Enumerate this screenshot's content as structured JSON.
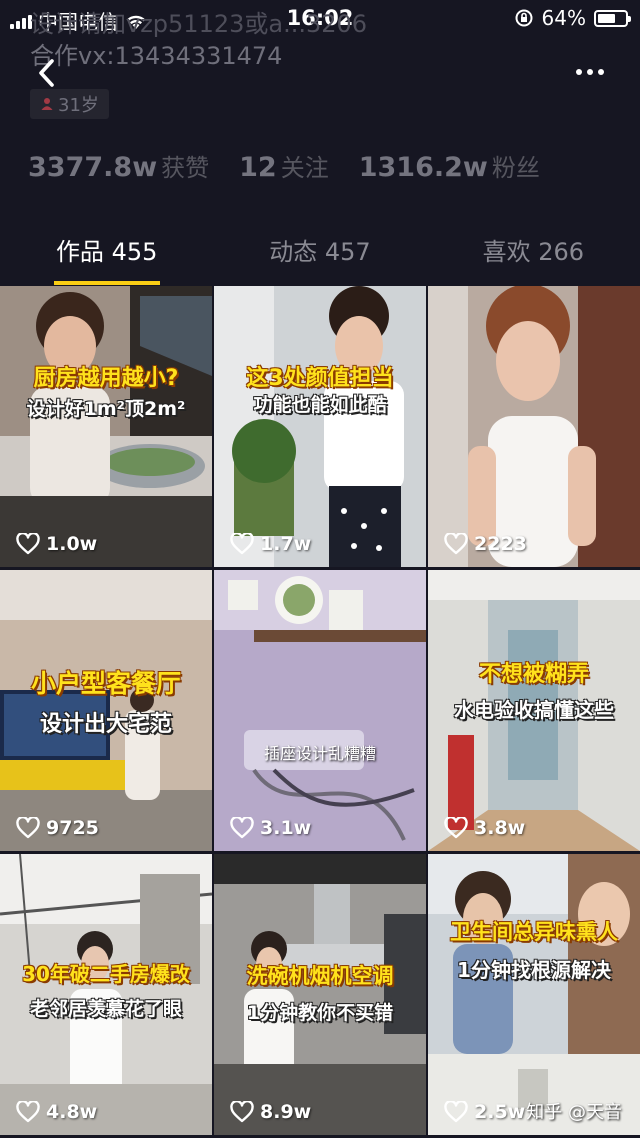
{
  "status_bar": {
    "carrier": "中国电信",
    "time": "16:02",
    "battery_text": "64%",
    "battery_level": 0.64
  },
  "profile": {
    "overlay_line1": "设计请加vzp51123或a...3206",
    "contact": "合作vx:13434331474",
    "age": "31岁",
    "stats": [
      {
        "number": "3377.8w",
        "label": "获赞"
      },
      {
        "number": "12",
        "label": "关注"
      },
      {
        "number": "1316.2w",
        "label": "粉丝"
      }
    ]
  },
  "tabs": [
    {
      "label": "作品 455",
      "active": true
    },
    {
      "label": "动态 457",
      "active": false
    },
    {
      "label": "喜欢 266",
      "active": false
    }
  ],
  "videos": [
    {
      "likes": "1.0w",
      "caption1": "厨房越用越小?",
      "caption2": "设计好1m²顶2m²"
    },
    {
      "likes": "1.7w",
      "caption1": "这3处颜值担当",
      "caption2": "功能也能如此酷"
    },
    {
      "likes": "2223"
    },
    {
      "likes": "9725",
      "caption1": "小户型客餐厅",
      "caption2": "设计出大宅范"
    },
    {
      "likes": "3.1w",
      "caption1": "插座设计乱糟糟"
    },
    {
      "likes": "3.8w",
      "caption1": "不想被糊弄",
      "caption2": "水电验收搞懂这些"
    },
    {
      "likes": "4.8w",
      "caption1": "30年破二手房爆改",
      "caption2": "老邻居羡慕花了眼"
    },
    {
      "likes": "8.9w",
      "caption1": "洗碗机烟机空调",
      "caption2": "1分钟教你不买错"
    },
    {
      "likes": "2.5w",
      "caption1": "卫生间总异味熏人",
      "caption2": "1分钟找根源解决"
    }
  ],
  "watermark": "知乎 @天音",
  "colors": {
    "background": "#161622",
    "tab_indicator": "#face15",
    "caption_yellow": "#ffe21c"
  }
}
